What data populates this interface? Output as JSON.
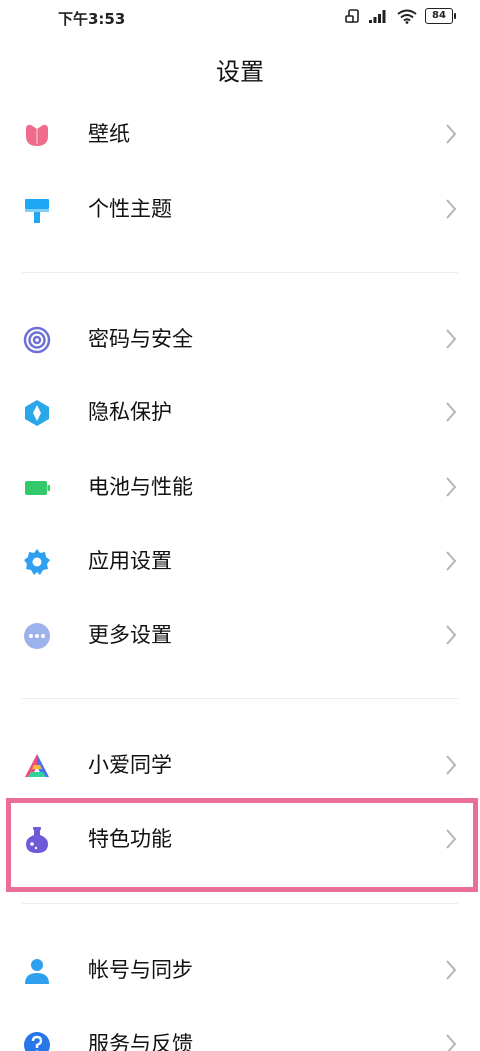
{
  "status_bar": {
    "time": "下午3:53",
    "battery_level": "84",
    "icons": [
      "rotation-lock-icon",
      "signal-icon",
      "wifi-icon",
      "battery-icon"
    ]
  },
  "header": {
    "title": "设置"
  },
  "settings": {
    "items": [
      {
        "label": "壁纸",
        "icon": "tulip-icon",
        "color": "#ef6b8a"
      },
      {
        "label": "个性主题",
        "icon": "paint-roller-icon",
        "color": "#1ea7f3"
      },
      {
        "label": "密码与安全",
        "icon": "fingerprint-icon",
        "color": "#6f6fd8"
      },
      {
        "label": "隐私保护",
        "icon": "privacy-shield-icon",
        "color": "#2aa7e8"
      },
      {
        "label": "电池与性能",
        "icon": "battery-icon",
        "color": "#32c96a"
      },
      {
        "label": "应用设置",
        "icon": "gear-icon",
        "color": "#2f9ff0"
      },
      {
        "label": "更多设置",
        "icon": "more-dots-icon",
        "color": "#9bb2ea"
      },
      {
        "label": "小爱同学",
        "icon": "xiaoai-icon",
        "color": "#4b6ff0"
      },
      {
        "label": "特色功能",
        "icon": "flask-icon",
        "color": "#6d5bd8"
      },
      {
        "label": "帐号与同步",
        "icon": "person-icon",
        "color": "#2f9ff0"
      },
      {
        "label": "服务与反馈",
        "icon": "question-icon",
        "color": "#2677e8"
      }
    ]
  },
  "highlight": {
    "color": "#ea6f96"
  }
}
